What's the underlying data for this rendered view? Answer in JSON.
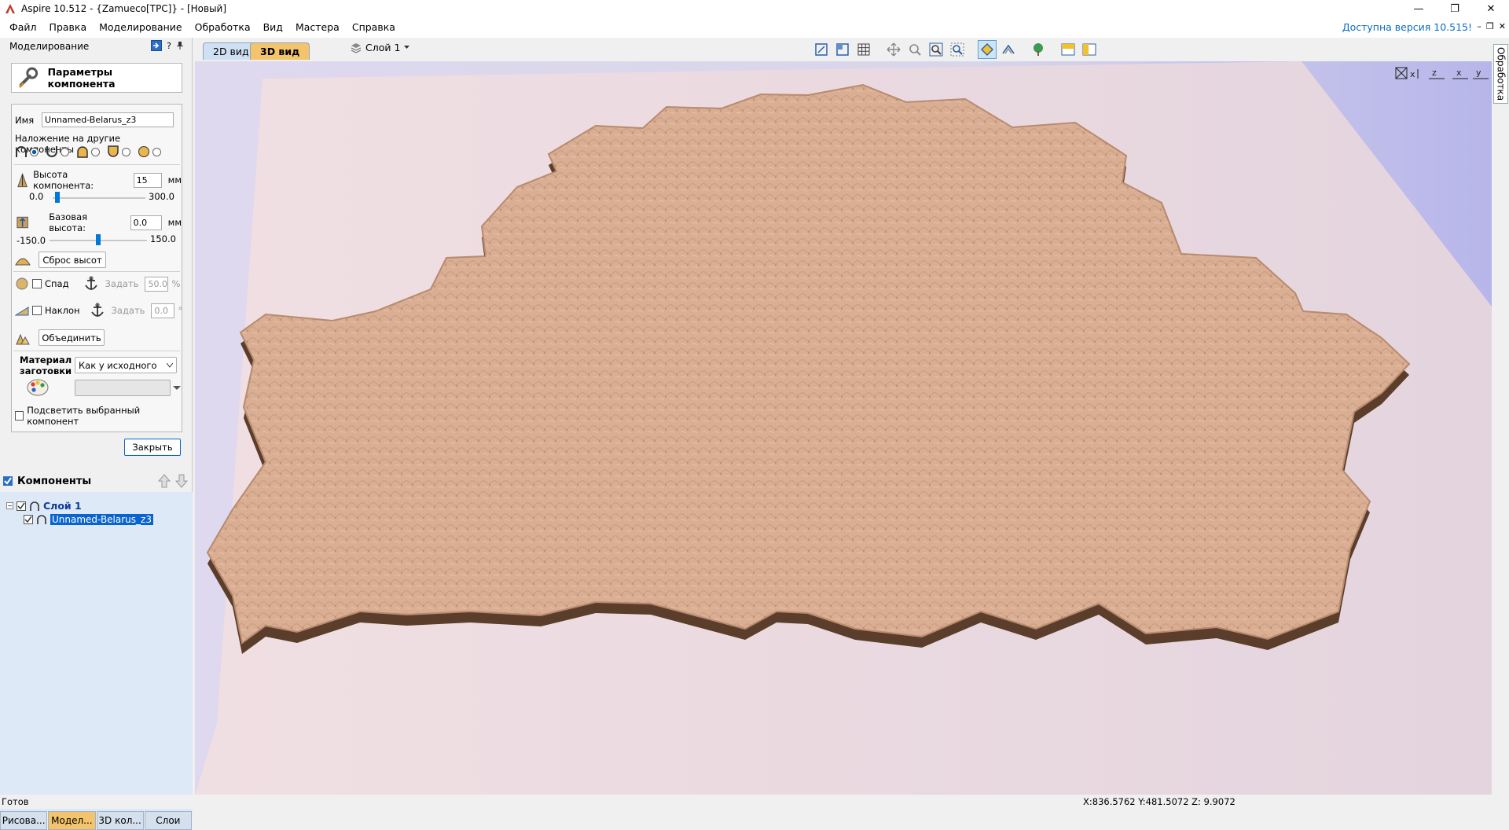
{
  "window": {
    "title": "Aspire 10.512 - {Zamueco[TPC]} - [Новый]",
    "minimize": "—",
    "maximize": "❐",
    "close": "✕"
  },
  "menu": {
    "items": [
      "Файл",
      "Правка",
      "Моделирование",
      "Обработка",
      "Вид",
      "Мастера",
      "Справка"
    ],
    "update_notice": "Доступна версия 10.515!"
  },
  "left_panel": {
    "header": "Моделирование",
    "help": "?",
    "component_params_label": "Параметры компонента",
    "name_label": "Имя",
    "name_value": "Unnamed-Belarus_z3",
    "overlay_label": "Наложение на другие компоненты",
    "height_label": "Высота компонента:",
    "height_value": "15",
    "height_unit": "мм",
    "height_min": "0.0",
    "height_max": "300.0",
    "height_fraction": 0.05,
    "base_label": "Базовая высота:",
    "base_value": "0.0",
    "base_unit": "мм",
    "base_min": "-150.0",
    "base_max": "150.0",
    "base_fraction": 0.5,
    "reset_heights": "Сброс высот",
    "fade_label": "Спад",
    "fade_set": "Задать",
    "fade_value": "50.0",
    "fade_unit": "%",
    "tilt_label": "Наклон",
    "tilt_set": "Задать",
    "tilt_value": "0.0",
    "tilt_unit": "°",
    "merge": "Объединить",
    "material_label_1": "Материал",
    "material_label_2": "заготовки",
    "material_value": "Как у исходного",
    "highlight_label": "Подсветить выбранный компонент",
    "close": "Закрыть"
  },
  "components": {
    "title": "Компоненты",
    "layer": "Слой 1",
    "item": "Unnamed-Belarus_z3"
  },
  "bottom_tabs": [
    "Рисова...",
    "Модел...",
    "3D кол...",
    "Слои"
  ],
  "view": {
    "tab_2d": "2D вид",
    "tab_3d": "3D вид",
    "layer_select": "Слой 1",
    "right_tab": "Обработка"
  },
  "colors": {
    "relief": "#d9ae93",
    "relief_shadow": "#5a3d2a",
    "accent": "#0078d7",
    "tab_active": "#f3c46b"
  },
  "status": {
    "text": "Готов",
    "coords": "X:836.5762 Y:481.5072 Z:  9.9072"
  }
}
